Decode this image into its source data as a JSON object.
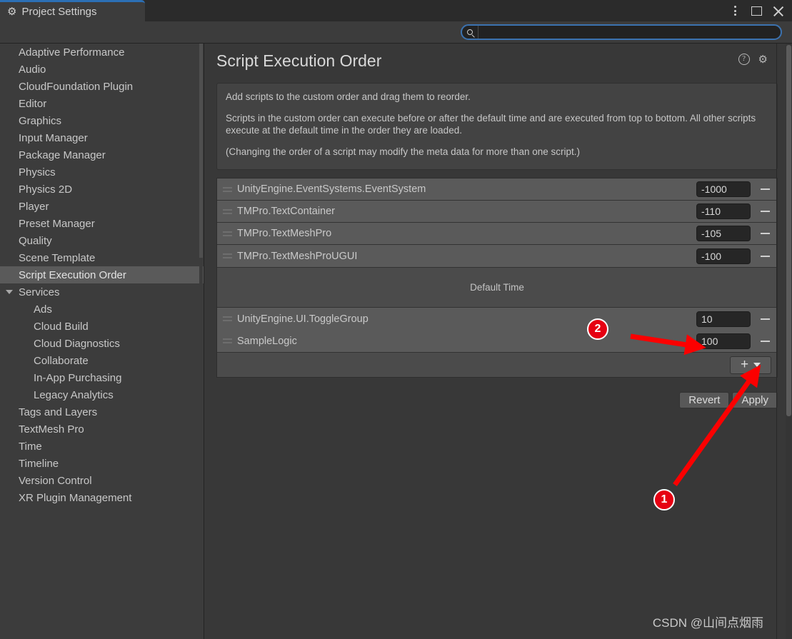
{
  "window": {
    "tab_label": "Project Settings",
    "tab_icon": "gear-icon",
    "controls": [
      {
        "name": "more-menu",
        "icon": "vertical-dots-icon"
      },
      {
        "name": "maximize",
        "icon": "maximize-square-icon"
      },
      {
        "name": "close",
        "icon": "close-x-icon"
      }
    ]
  },
  "search": {
    "value": "",
    "placeholder": "",
    "icon": "search-icon",
    "focus_color": "#3b72b0"
  },
  "sidebar": {
    "items": [
      {
        "label": "Adaptive Performance",
        "level": 0,
        "selected": false,
        "expandable": false
      },
      {
        "label": "Audio",
        "level": 0,
        "selected": false,
        "expandable": false
      },
      {
        "label": "CloudFoundation Plugin",
        "level": 0,
        "selected": false,
        "expandable": false
      },
      {
        "label": "Editor",
        "level": 0,
        "selected": false,
        "expandable": false
      },
      {
        "label": "Graphics",
        "level": 0,
        "selected": false,
        "expandable": false
      },
      {
        "label": "Input Manager",
        "level": 0,
        "selected": false,
        "expandable": false
      },
      {
        "label": "Package Manager",
        "level": 0,
        "selected": false,
        "expandable": false
      },
      {
        "label": "Physics",
        "level": 0,
        "selected": false,
        "expandable": false
      },
      {
        "label": "Physics 2D",
        "level": 0,
        "selected": false,
        "expandable": false
      },
      {
        "label": "Player",
        "level": 0,
        "selected": false,
        "expandable": false
      },
      {
        "label": "Preset Manager",
        "level": 0,
        "selected": false,
        "expandable": false
      },
      {
        "label": "Quality",
        "level": 0,
        "selected": false,
        "expandable": false
      },
      {
        "label": "Scene Template",
        "level": 0,
        "selected": false,
        "expandable": false
      },
      {
        "label": "Script Execution Order",
        "level": 0,
        "selected": true,
        "expandable": false
      },
      {
        "label": "Services",
        "level": 0,
        "selected": false,
        "expandable": true
      },
      {
        "label": "Ads",
        "level": 1,
        "selected": false,
        "expandable": false
      },
      {
        "label": "Cloud Build",
        "level": 1,
        "selected": false,
        "expandable": false
      },
      {
        "label": "Cloud Diagnostics",
        "level": 1,
        "selected": false,
        "expandable": false
      },
      {
        "label": "Collaborate",
        "level": 1,
        "selected": false,
        "expandable": false
      },
      {
        "label": "In-App Purchasing",
        "level": 1,
        "selected": false,
        "expandable": false
      },
      {
        "label": "Legacy Analytics",
        "level": 1,
        "selected": false,
        "expandable": false
      },
      {
        "label": "Tags and Layers",
        "level": 0,
        "selected": false,
        "expandable": false
      },
      {
        "label": "TextMesh Pro",
        "level": 0,
        "selected": false,
        "expandable": false
      },
      {
        "label": "Time",
        "level": 0,
        "selected": false,
        "expandable": false
      },
      {
        "label": "Timeline",
        "level": 0,
        "selected": false,
        "expandable": false
      },
      {
        "label": "Version Control",
        "level": 0,
        "selected": false,
        "expandable": false
      },
      {
        "label": "XR Plugin Management",
        "level": 0,
        "selected": false,
        "expandable": false
      }
    ]
  },
  "page": {
    "title": "Script Execution Order",
    "help_icon": "help-question-icon",
    "settings_icon": "gear-icon",
    "info_paragraphs": [
      "Add scripts to the custom order and drag them to reorder.",
      "Scripts in the custom order can execute before or after the default time and are executed from top to bottom. All other scripts execute at the default time in the order they are loaded.",
      "(Changing the order of a script may modify the meta data for more than one script.)"
    ],
    "default_time_label": "Default Time",
    "rows_before_default": [
      {
        "name": "UnityEngine.EventSystems.EventSystem",
        "value": "-1000"
      },
      {
        "name": "TMPro.TextContainer",
        "value": "-110"
      },
      {
        "name": "TMPro.TextMeshPro",
        "value": "-105"
      },
      {
        "name": "TMPro.TextMeshProUGUI",
        "value": "-100"
      }
    ],
    "rows_after_default": [
      {
        "name": "UnityEngine.UI.ToggleGroup",
        "value": "10"
      },
      {
        "name": "SampleLogic",
        "value": "100"
      }
    ],
    "add_button": {
      "plus": "+",
      "caret": "chevron-down-icon"
    },
    "revert_label": "Revert",
    "apply_label": "Apply"
  },
  "annotations": {
    "badge1": "1",
    "badge2": "2",
    "arrow_color": "#fc0000",
    "badge_color": "#e60012"
  },
  "watermark": "CSDN @山间点烟雨"
}
